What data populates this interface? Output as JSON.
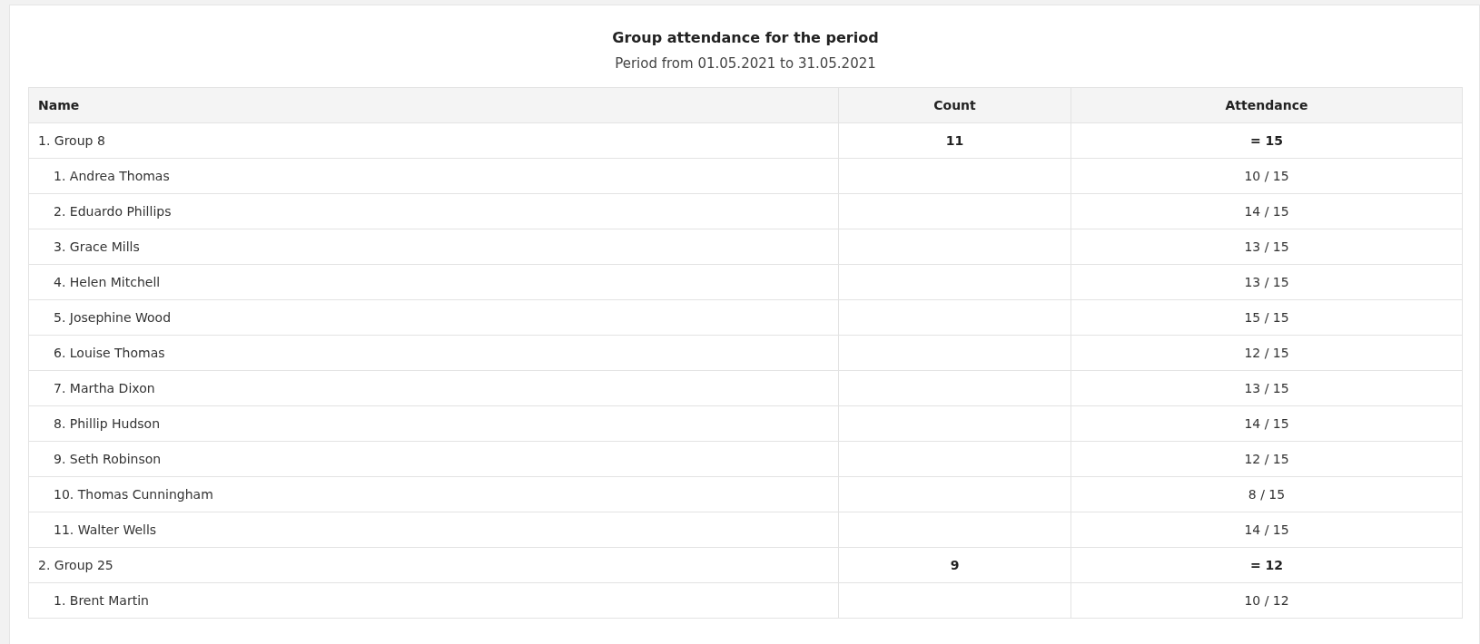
{
  "report": {
    "title": "Group attendance for the period",
    "subtitle": "Period from 01.05.2021 to 31.05.2021"
  },
  "table": {
    "columns": [
      "Name",
      "Count",
      "Attendance"
    ],
    "groups": [
      {
        "name": "1. Group 8",
        "count": "11",
        "attendance": "= 15",
        "children": [
          {
            "name": "1. Andrea Thomas",
            "attendance": "10 / 15"
          },
          {
            "name": "2. Eduardo Phillips",
            "attendance": "14 / 15"
          },
          {
            "name": "3. Grace Mills",
            "attendance": "13 / 15"
          },
          {
            "name": "4. Helen Mitchell",
            "attendance": "13 / 15"
          },
          {
            "name": "5. Josephine Wood",
            "attendance": "15 / 15"
          },
          {
            "name": "6. Louise Thomas",
            "attendance": "12 / 15"
          },
          {
            "name": "7. Martha Dixon",
            "attendance": "13 / 15"
          },
          {
            "name": "8. Phillip Hudson",
            "attendance": "14 / 15"
          },
          {
            "name": "9. Seth Robinson",
            "attendance": "12 / 15"
          },
          {
            "name": "10. Thomas Cunningham",
            "attendance": "8 / 15"
          },
          {
            "name": "11. Walter Wells",
            "attendance": "14 / 15"
          }
        ]
      },
      {
        "name": "2. Group 25",
        "count": "9",
        "attendance": "= 12",
        "children": [
          {
            "name": "1. Brent Martin",
            "attendance": "10 / 12"
          }
        ]
      }
    ]
  }
}
